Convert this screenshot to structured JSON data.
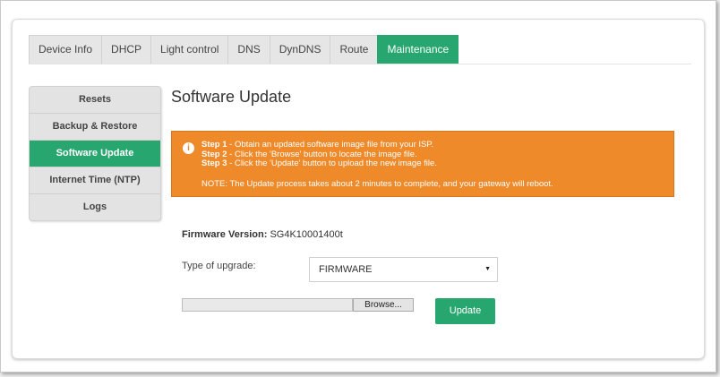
{
  "tabs": [
    "Device Info",
    "DHCP",
    "Light control",
    "DNS",
    "DynDNS",
    "Route",
    "Maintenance"
  ],
  "active_tab": "Maintenance",
  "sidebar": {
    "items": [
      "Resets",
      "Backup & Restore",
      "Software Update",
      "Internet Time (NTP)",
      "Logs"
    ],
    "active": "Software Update"
  },
  "page": {
    "title": "Software Update"
  },
  "alert": {
    "icon": "info-icon",
    "step1_label": "Step 1",
    "step1_text": " - Obtain an updated software image file from your ISP.",
    "step2_label": "Step 2",
    "step2_text": " - Click the 'Browse' button to locate the image file.",
    "step3_label": "Step 3",
    "step3_text": " - Click the 'Update' button to upload the new image file.",
    "note": "NOTE: The Update process takes about 2 minutes to complete, and your gateway will reboot.",
    "color": "#ef8a2a"
  },
  "firmware": {
    "label": "Firmware Version:",
    "value": "SG4K10001400t"
  },
  "upgrade": {
    "label": "Type of upgrade:",
    "selected": "FIRMWARE"
  },
  "file": {
    "browse_label": "Browse..."
  },
  "update_label": "Update",
  "colors": {
    "accent": "#27a66f",
    "alert": "#ef8a2a"
  }
}
